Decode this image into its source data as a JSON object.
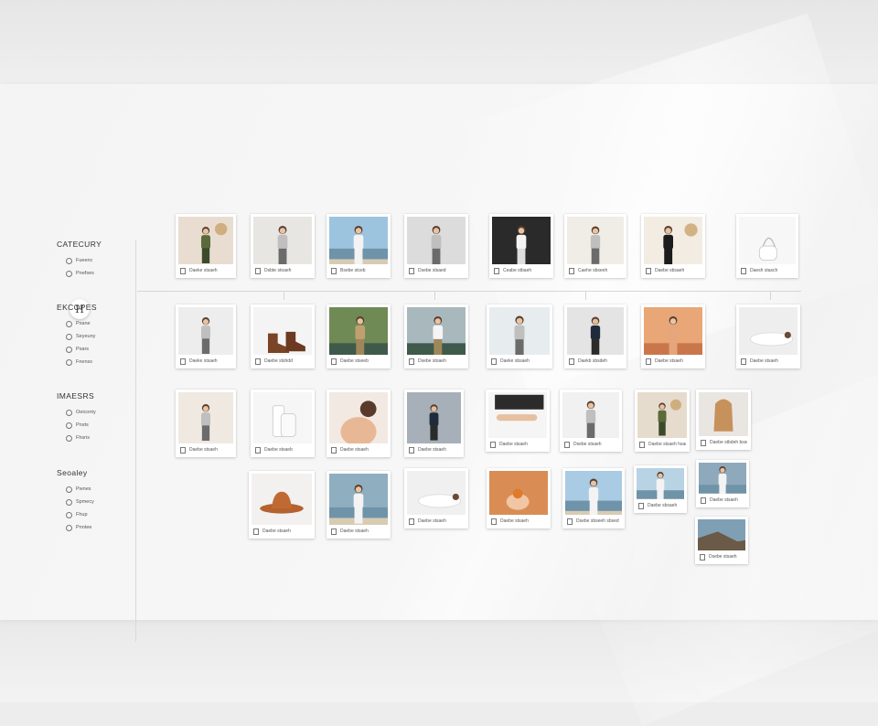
{
  "sidebar": {
    "logo_glyph": "H",
    "groups": [
      {
        "title": "CATECURY",
        "items": [
          "Fueenc",
          "Pnefses"
        ]
      },
      {
        "title": "EKCOPES",
        "items": [
          "Pxane",
          "Seyeuny",
          "Psars",
          "Fnenss"
        ]
      },
      {
        "title": "IMAESRS",
        "items": [
          "Oeiconty",
          "Pnsts",
          "Fhsris"
        ]
      },
      {
        "title": "Seoaley",
        "items": [
          "Pwnes",
          "Spmecy",
          "Fhup",
          "Pnntee"
        ]
      }
    ]
  },
  "cards": [
    {
      "caption": "Daeke stsaeh",
      "photo": "woman-plants"
    },
    {
      "caption": "Dsbte stoaeh",
      "photo": "woman-white-dress-beach"
    },
    {
      "caption": "Bsebe stceb",
      "photo": "woman-beach"
    },
    {
      "caption": "Dsebe stsaed",
      "photo": "woman-dancing"
    },
    {
      "caption": "Ceabe stbaeh",
      "photo": "woman-dark-portrait"
    },
    {
      "caption": "Caehe sbseeh",
      "photo": "woman-beige"
    },
    {
      "caption": "Daebe sbsaeh",
      "photo": "woman-black-top"
    },
    {
      "caption": "Daesh stasch",
      "photo": "white-bag"
    },
    {
      "caption": "Daeke stsaeh",
      "photo": "woman-grey-sweater"
    },
    {
      "caption": "Daebe stshdd",
      "photo": "brown-boots"
    },
    {
      "caption": "Daebe stseeb",
      "photo": "woman-floral-dress"
    },
    {
      "caption": "Dsebe stoaeh",
      "photo": "woman-veil-sea"
    },
    {
      "caption": "Daeke sbsaeh",
      "photo": "woman-sitting-grass"
    },
    {
      "caption": "Daekb sbsdeh",
      "photo": "man-dark-outfit"
    },
    {
      "caption": "Daebe stsaeh",
      "photo": "woman-sunset"
    },
    {
      "caption": "Daebe stsaeh",
      "photo": "woman-lying-white"
    },
    {
      "caption": "Daebe stsaeh",
      "photo": "woman-dark-hair-room"
    },
    {
      "caption": "Daebe stsaeb",
      "photo": "white-boots"
    },
    {
      "caption": "Daebe stsaeh",
      "photo": "woman-shoulder"
    },
    {
      "caption": "Daebe stsaeh",
      "photo": "man-blazer"
    },
    {
      "caption": "Daebe stsaeh",
      "photo": "arm-pose"
    },
    {
      "caption": "Dsebe stsaeh",
      "photo": "woman-white-top"
    },
    {
      "caption": "Daebe stsaeh hsaeeb",
      "photo": "woman-green-dress"
    },
    {
      "caption": "Daebe stbdeh bssedf",
      "photo": "woman-long-hair-back"
    },
    {
      "caption": "Daebe stsaeh",
      "photo": "brown-hat"
    },
    {
      "caption": "Daebe stsaeh",
      "photo": "woman-sea-walk"
    },
    {
      "caption": "Daebe stsaeh",
      "photo": "woman-lace-lying"
    },
    {
      "caption": "Daebe stsaeh",
      "photo": "hands-orange"
    },
    {
      "caption": "Dsebe sbseeh sbsed",
      "photo": "man-hill"
    },
    {
      "caption": "Daebe sbsaeh",
      "photo": "woman-shore"
    },
    {
      "caption": "Daebe stsaeh",
      "photo": "woman-waves"
    },
    {
      "caption": "Dsebe stsaeh",
      "photo": "coast-road"
    }
  ]
}
